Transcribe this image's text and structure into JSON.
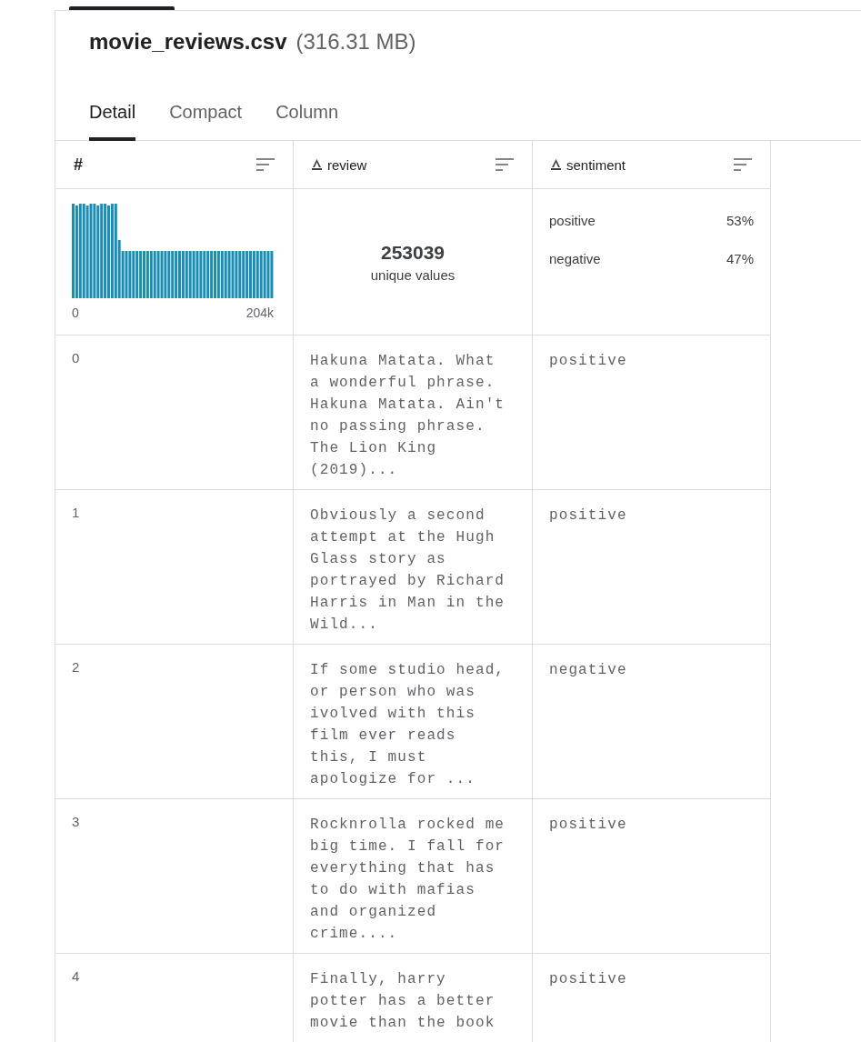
{
  "file": {
    "name": "movie_reviews.csv",
    "size": "(316.31 MB)"
  },
  "tabs": [
    {
      "label": "Detail",
      "selected": true
    },
    {
      "label": "Compact",
      "selected": false
    },
    {
      "label": "Column",
      "selected": false
    }
  ],
  "table": {
    "columns": [
      {
        "label": "#",
        "kind": "number"
      },
      {
        "label": "review",
        "kind": "text"
      },
      {
        "label": "sentiment",
        "kind": "text"
      }
    ],
    "summary": {
      "histogram": {
        "min_label": "0",
        "max_label": "204k"
      },
      "unique": {
        "count": "253039",
        "label": "unique values"
      },
      "categories": [
        {
          "label": "positive",
          "share": "53%"
        },
        {
          "label": "negative",
          "share": "47%"
        }
      ]
    },
    "rows": [
      {
        "index": "0",
        "review": "Hakuna Matata. What\na wonderful phrase.\nHakuna Matata. Ain't\nno passing phrase.\nThe Lion King\n(2019)...",
        "sentiment": "positive"
      },
      {
        "index": "1",
        "review": "Obviously a second\nattempt at the Hugh\nGlass story as\nportrayed by Richard\nHarris in Man in the\nWild...",
        "sentiment": "positive"
      },
      {
        "index": "2",
        "review": "If some studio head,\nor person who was\nivolved with this\nfilm ever reads\nthis, I must\napologize for ...",
        "sentiment": "negative"
      },
      {
        "index": "3",
        "review": "Rocknrolla rocked me\nbig time. I fall for\neverything that has\nto do with mafias\nand organized\ncrime....",
        "sentiment": "positive"
      },
      {
        "index": "4",
        "review": "Finally, harry\npotter has a better\nmovie than the book",
        "sentiment": "positive"
      }
    ]
  }
}
